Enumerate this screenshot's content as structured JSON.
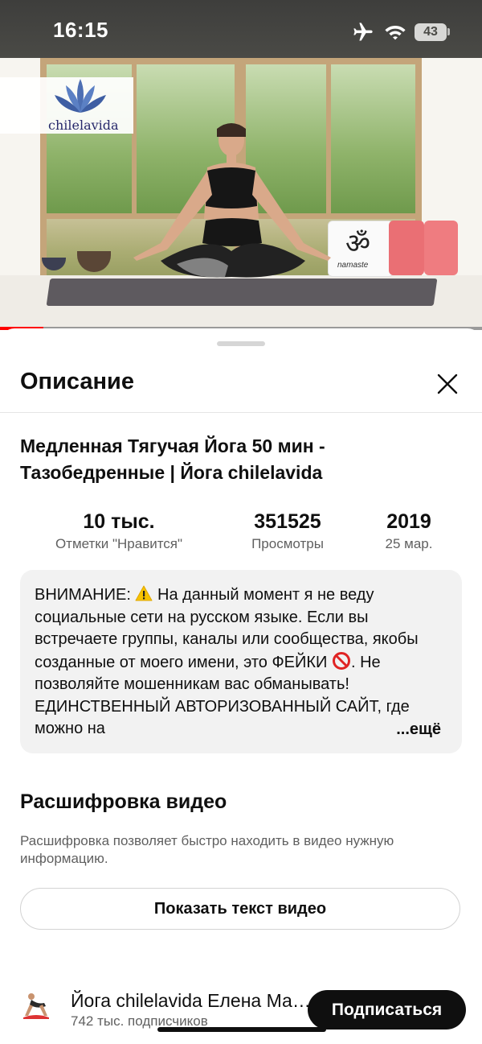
{
  "status_bar": {
    "time": "16:15",
    "battery": "43",
    "icons": [
      "airplane-icon",
      "wifi-icon",
      "battery-icon"
    ]
  },
  "video": {
    "logo_text": "chilelavida",
    "pillow_text": "namaste",
    "progress_fraction": 0.09,
    "progress_color": "#ff0000"
  },
  "sheet": {
    "title": "Описание",
    "video_title": "Медленная Тягучая Йога 50 мин - Тазобедренные | Йога chilelavida",
    "stats": [
      {
        "value": "10 тыс.",
        "label": "Отметки \"Нравится\""
      },
      {
        "value": "351525",
        "label": "Просмотры"
      },
      {
        "value": "2019",
        "label": "25 мар."
      }
    ],
    "description": {
      "part1": "ВНИМАНИЕ: ",
      "part2": " На данный момент я не веду социальные сети на русском языке. Если вы встречаете группы, каналы или сообщества, якобы созданные от моего имени, это ФЕЙКИ ",
      "part3": ". Не позволяйте мошенникам вас обманывать! ЕДИНСТВЕННЫЙ АВТОРИЗОВАННЫЙ САЙТ, где можно на",
      "more": "...ещё"
    },
    "transcript": {
      "title": "Расшифровка видео",
      "subtitle": "Расшифровка позволяет быстро находить в видео нужную информацию.",
      "button_label": "Показать текст видео"
    },
    "channel": {
      "name": "Йога chilelavida Елена Малова",
      "subscribers": "742 тыс. подписчиков",
      "subscribe_label": "Подписаться"
    }
  },
  "colors": {
    "accent": "#ff0000",
    "text_primary": "#0f0f0f",
    "text_secondary": "#606060",
    "description_bg": "#f2f2f2",
    "subscribe_bg": "#0f0f0f"
  }
}
